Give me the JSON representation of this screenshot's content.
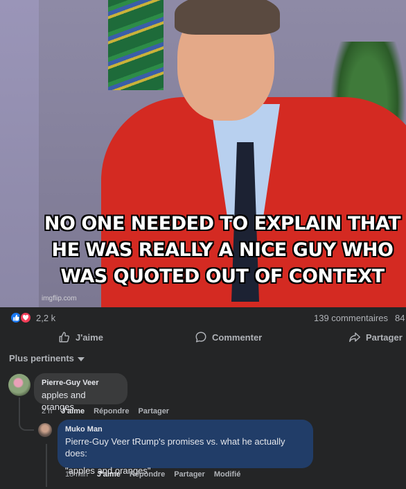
{
  "post": {
    "image": {
      "caption_line1": "NO ONE NEEDED TO EXPLAIN THAT",
      "caption_line2": "HE WAS REALLY A NICE GUY WHO",
      "caption_line3": "WAS QUOTED OUT OF CONTEXT",
      "watermark": "imgflip.com"
    },
    "reactions": {
      "icons": [
        "like-icon",
        "love-icon"
      ],
      "count": "2,2 k",
      "comments": "139 commentaires",
      "shares": "84"
    },
    "actions": {
      "like": "J'aime",
      "comment": "Commenter",
      "share": "Partager"
    }
  },
  "comments_section": {
    "sort_label": "Plus pertinents",
    "comments": [
      {
        "author": "Pierre-Guy Veer",
        "text": "apples and oranges",
        "time": "2 h",
        "like": "J'aime",
        "reply": "Répondre",
        "share": "Partager"
      },
      {
        "author": "Muko Man",
        "text_line1": "Pierre-Guy Veer tRump's promises vs. what he actually does:",
        "text_line2": "\"apples and oranges\"",
        "time": "18 min",
        "like": "J'aime",
        "reply": "Répondre",
        "share": "Partager",
        "edited": "Modifié"
      }
    ]
  },
  "colors": {
    "background": "#242526",
    "bubble": "#3a3b3c",
    "highlight_bubble": "#213d68",
    "like_blue": "#1877f2",
    "love_red": "#f33e58"
  }
}
